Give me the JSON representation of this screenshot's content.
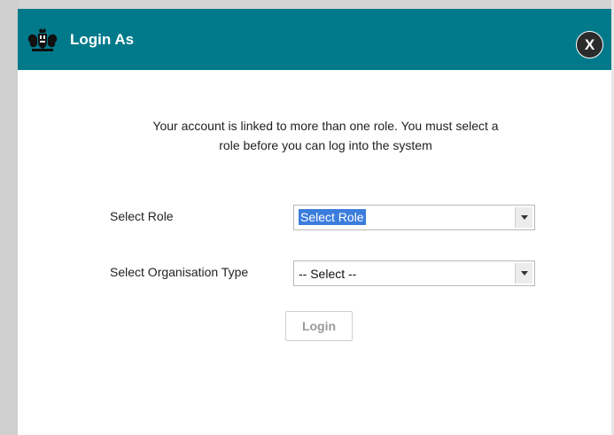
{
  "dialog": {
    "title": "Login As",
    "close_label": "X",
    "message": "Your account is linked to more than one role. You must select a role before you can log into the system"
  },
  "form": {
    "role": {
      "label": "Select Role",
      "selected_value": "Select Role"
    },
    "organisation_type": {
      "label": "Select Organisation Type",
      "selected_value": "-- Select --"
    },
    "login_button": "Login",
    "login_enabled": false
  },
  "colors": {
    "header": "#007a8a",
    "close_button": "#2b2b2b",
    "selection_highlight": "#3b7ddd"
  },
  "icons": {
    "crest": "royal-coat-of-arms-icon",
    "dropdown": "chevron-down-icon"
  }
}
